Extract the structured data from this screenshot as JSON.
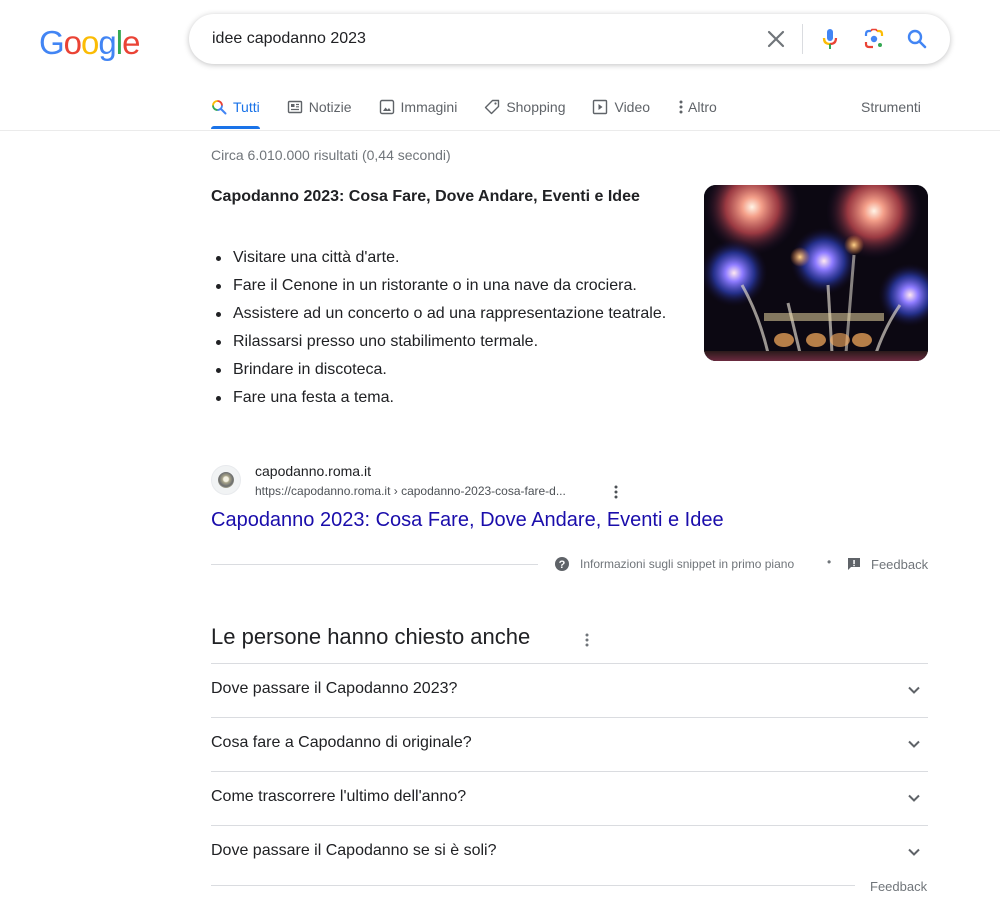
{
  "header": {
    "logo_letters": [
      {
        "char": "G",
        "color": "#4285f4"
      },
      {
        "char": "o",
        "color": "#ea4335"
      },
      {
        "char": "o",
        "color": "#fbbc05"
      },
      {
        "char": "g",
        "color": "#4285f4"
      },
      {
        "char": "l",
        "color": "#34a853"
      },
      {
        "char": "e",
        "color": "#ea4335"
      }
    ],
    "search": {
      "value": "idee capodanno 2023",
      "clear_icon": "close-icon",
      "mic_icon": "microphone-icon",
      "lens_icon": "google-lens-icon",
      "search_icon": "search-icon"
    }
  },
  "tabs": {
    "items": [
      {
        "label": "Tutti",
        "icon": "search-icon",
        "active": true
      },
      {
        "label": "Notizie",
        "icon": "news-icon",
        "active": false
      },
      {
        "label": "Immagini",
        "icon": "image-icon",
        "active": false
      },
      {
        "label": "Shopping",
        "icon": "tag-icon",
        "active": false
      },
      {
        "label": "Video",
        "icon": "play-icon",
        "active": false
      },
      {
        "label": "Altro",
        "icon": "more-vertical-icon",
        "active": false
      }
    ],
    "tools_label": "Strumenti",
    "accent_color": "#1a73e8"
  },
  "result_stats": "Circa 6.010.000 risultati (0,44 secondi)",
  "featured_snippet": {
    "title": "Capodanno 2023: Cosa Fare, Dove Andare, Eventi e Idee",
    "items": [
      "Visitare una città d'arte.",
      "Fare il Cenone in un ristorante o in una nave da crociera.",
      "Assistere ad un concerto o ad una rappresentazione teatrale.",
      "Rilassarsi presso uno stabilimento termale.",
      "Brindare in discoteca.",
      "Fare una festa a tema."
    ],
    "image_alt": "fireworks",
    "source": {
      "name": "capodanno.roma.it",
      "url": "https://capodanno.roma.it › capodanno-2023-cosa-fare-d..."
    },
    "link_text": "Capodanno 2023: Cosa Fare, Dove Andare, Eventi e Idee",
    "link_color": "#1a0dab",
    "about_label": "Informazioni sugli snippet in primo piano",
    "separator": "•",
    "feedback_label": "Feedback"
  },
  "people_also_ask": {
    "title": "Le persone hanno chiesto anche",
    "questions": [
      "Dove passare il Capodanno 2023?",
      "Cosa fare a Capodanno di originale?",
      "Come trascorrere l'ultimo dell'anno?",
      "Dove passare il Capodanno se si è soli?"
    ],
    "feedback_label": "Feedback"
  }
}
